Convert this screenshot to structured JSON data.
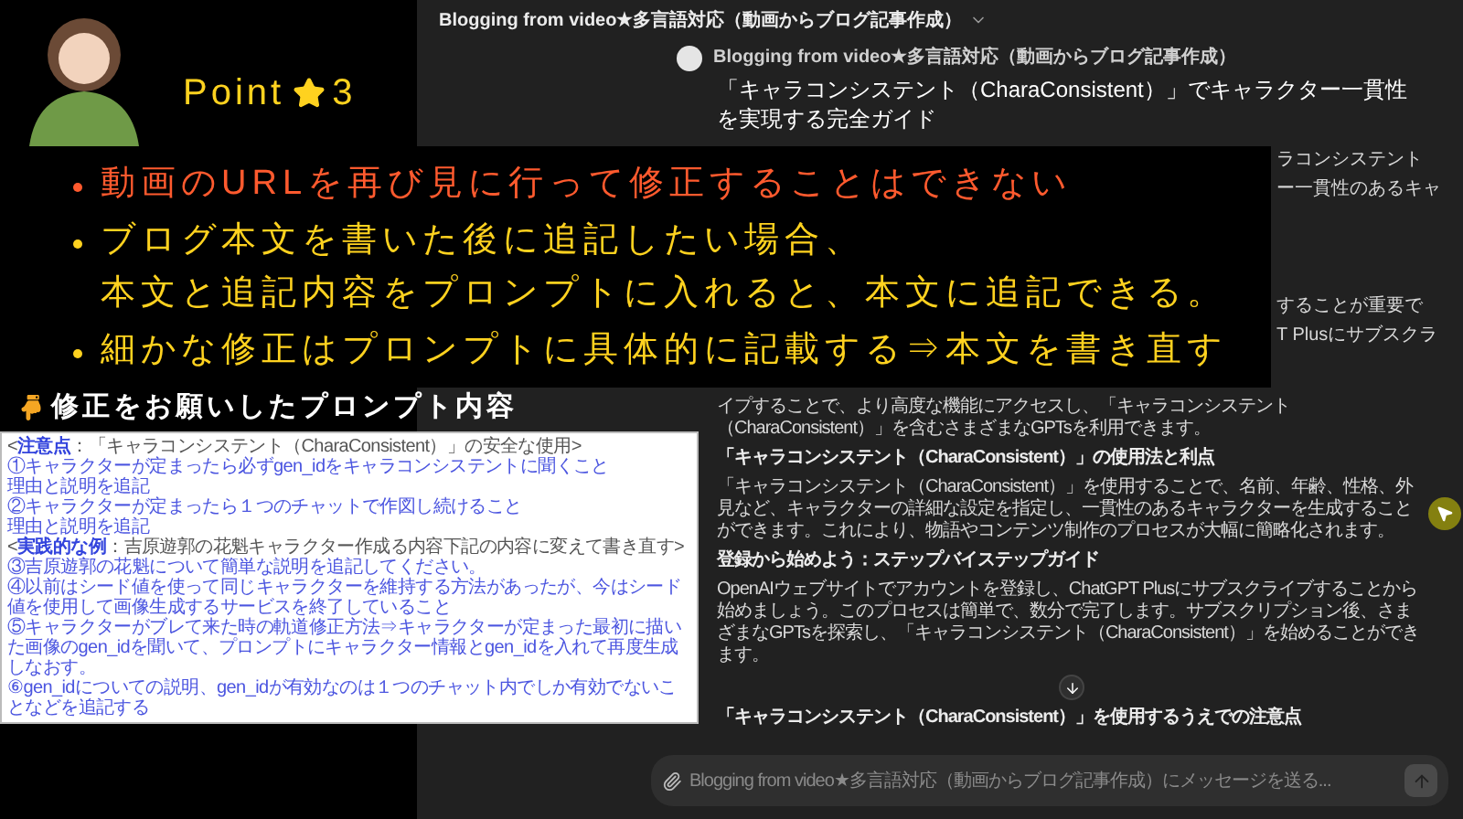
{
  "chat_header": {
    "title": "Blogging from video★多言語対応（動画からブログ記事作成）"
  },
  "message": {
    "sender": "Blogging from video★多言語対応（動画からブログ記事作成）",
    "title": "「キャラコンシステント（CharaConsistent）」でキャラクター一貫性を実現する完全ガイド",
    "partial_lines": [
      "ラコンシステント",
      "ー一貫性のあるキャ",
      "することが重要で",
      "T Plusにサブスクラ"
    ],
    "blocks": [
      {
        "kind": "paragraph",
        "text": "イプすることで、より高度な機能にアクセスし、「キャラコンシステント（CharaConsistent）」を含むさまざまなGPTsを利用できます。"
      },
      {
        "kind": "heading",
        "text": "「キャラコンシステント（CharaConsistent）」の使用法と利点"
      },
      {
        "kind": "paragraph",
        "text": "「キャラコンシステント（CharaConsistent）」を使用することで、名前、年齢、性格、外見など、キャラクターの詳細な設定を指定し、一貫性のあるキャラクターを生成することができます。これにより、物語やコンテンツ制作のプロセスが大幅に簡略化されます。"
      },
      {
        "kind": "heading",
        "text": "登録から始めよう：ステップバイステップガイド"
      },
      {
        "kind": "paragraph",
        "text": "OpenAIウェブサイトでアカウントを登録し、ChatGPT Plusにサブスクライブすることから始めましょう。このプロセスは簡単で、数分で完了します。サブスクリプション後、さまざまなGPTsを探索し、「キャラコンシステント（CharaConsistent）」を始めることができます。"
      },
      {
        "kind": "heading",
        "text": "「キャラコンシステント（CharaConsistent）」を使用するうえでの注意点"
      }
    ]
  },
  "composer": {
    "placeholder": "Blogging from video★多言語対応（動画からブログ記事作成）にメッセージを送る..."
  },
  "point_label": {
    "text": "Point",
    "number": "3"
  },
  "overlay_points": [
    {
      "color": "#ff5a2e",
      "lines": [
        "動画のURLを再び見に行って修正することはできない"
      ]
    },
    {
      "color": "#ffd21f",
      "lines": [
        "ブログ本文を書いた後に追記したい場合、",
        "本文と追記内容をプロンプトに入れると、本文に追記できる。"
      ]
    },
    {
      "color": "#ffd21f",
      "lines": [
        "細かな修正はプロンプトに具体的に記載する⇒本文を書き直す"
      ]
    }
  ],
  "prompt_title": "修正をお願いしたプロンプト内容",
  "prompt_lines": [
    {
      "kind": "heading",
      "text": "<**注意点**：「キャラコンシステント（CharaConsistent）」の安全な使用>"
    },
    {
      "kind": "item",
      "text": "①キャラクターが定まったら必ずgen_idをキャラコンシステントに聞くこと"
    },
    {
      "kind": "item",
      "text": "理由と説明を追記"
    },
    {
      "kind": "item",
      "text": "②キャラクターが定まったら１つのチャットで作図し続けること"
    },
    {
      "kind": "item",
      "text": "理由と説明を追記"
    },
    {
      "kind": "heading",
      "text": "<**実践的な例**：吉原遊郭の花魁キャラクター作成る内容下記の内容に変えて書き直す>"
    },
    {
      "kind": "item",
      "text": "③吉原遊郭の花魁について簡単な説明を追記してください。"
    },
    {
      "kind": "item",
      "text": "④以前はシード値を使って同じキャラクターを維持する方法があったが、今はシード値を使用して画像生成するサービスを終了していること"
    },
    {
      "kind": "item",
      "text": "⑤キャラクターがブレて来た時の軌道修正方法⇒キャラクターが定まった最初に描いた画像のgen_idを聞いて、プロンプトにキャラクター情報とgen_idを入れて再度生成しなおす。"
    },
    {
      "kind": "item",
      "text": "⑥gen_idについての説明、gen_idが有効なのは１つのチャット内でしか有効でないことなどを追記する"
    }
  ]
}
